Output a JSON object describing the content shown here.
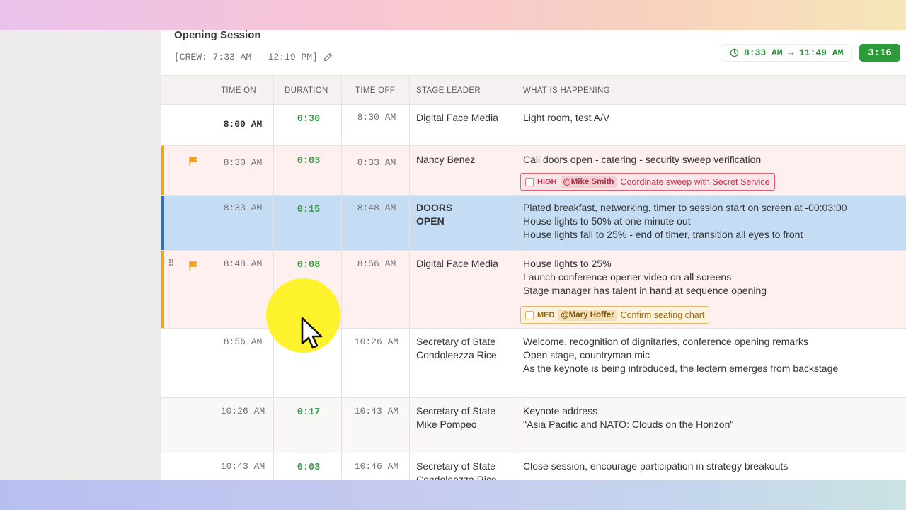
{
  "session": {
    "title": "Opening Session",
    "crew_label": "[CREW: 7:33 AM - 12:19 PM]",
    "time_range": "8:33 AM → 11:49 AM",
    "duration": "3:16"
  },
  "columns": {
    "time_on": "TIME ON",
    "duration": "DURATION",
    "time_off": "TIME OFF",
    "stage_leader": "STAGE LEADER",
    "what": "WHAT IS HAPPENING"
  },
  "rows": [
    {
      "time_on": "8:00 AM",
      "duration": "0:30",
      "time_off": "8:30 AM",
      "leader": "Digital Face Media",
      "what": [
        "Light room, test A/V"
      ]
    },
    {
      "time_on": "8:30 AM",
      "duration": "0:03",
      "time_off": "8:33 AM",
      "leader": "Nancy Benez",
      "what": [
        "Call doors open - catering - security sweep verification"
      ],
      "task": {
        "priority": "HIGH",
        "assignee": "@Mike Smith",
        "text": "Coordinate sweep with Secret Service"
      }
    },
    {
      "time_on": "8:33 AM",
      "duration": "0:15",
      "time_off": "8:48 AM",
      "leader": [
        "DOORS",
        "OPEN"
      ],
      "what": [
        "Plated breakfast, networking, timer to session start on screen at -00:03:00",
        "House lights to 50% at one minute out",
        "House lights fall to 25% - end of timer, transition all eyes to front"
      ]
    },
    {
      "time_on": "8:48 AM",
      "duration": "0:08",
      "time_off": "8:56 AM",
      "leader": "Digital Face Media",
      "what": [
        "House lights to 25%",
        "Launch conference opener video on all screens",
        "Stage manager has talent in hand at sequence opening"
      ],
      "task": {
        "priority": "MED",
        "assignee": "@Mary Hoffer",
        "text": "Confirm seating chart"
      }
    },
    {
      "time_on": "8:56 AM",
      "duration": "",
      "time_off": "10:26 AM",
      "leader": [
        "Secretary of State",
        "Condoleezza Rice"
      ],
      "what": [
        "Welcome, recognition of dignitaries, conference opening remarks",
        "Open stage, countryman mic",
        "As the keynote is being introduced, the lectern emerges from backstage"
      ]
    },
    {
      "time_on": "10:26 AM",
      "duration": "0:17",
      "time_off": "10:43 AM",
      "leader": [
        "Secretary of State",
        "Mike Pompeo"
      ],
      "what": [
        "Keynote address",
        "\"Asia Pacific and NATO: Clouds on the Horizon\""
      ]
    },
    {
      "time_on": "10:43 AM",
      "duration": "0:03",
      "time_off": "10:46 AM",
      "leader": [
        "Secretary of State",
        "Condoleezza Rice"
      ],
      "what": [
        "Close session, encourage participation in strategy breakouts"
      ]
    }
  ],
  "colors": {
    "accent_green": "#2e9b3a",
    "flag_orange": "#f0a21f",
    "selected_row": "#c5dcf5",
    "flagged_row": "#fdf0ef",
    "high_red": "#e35d70",
    "med_amber": "#e8b960"
  },
  "icons": [
    "pencil-icon",
    "clock-icon",
    "flag-icon",
    "drag-handle-icon",
    "cursor-pointer-icon"
  ]
}
